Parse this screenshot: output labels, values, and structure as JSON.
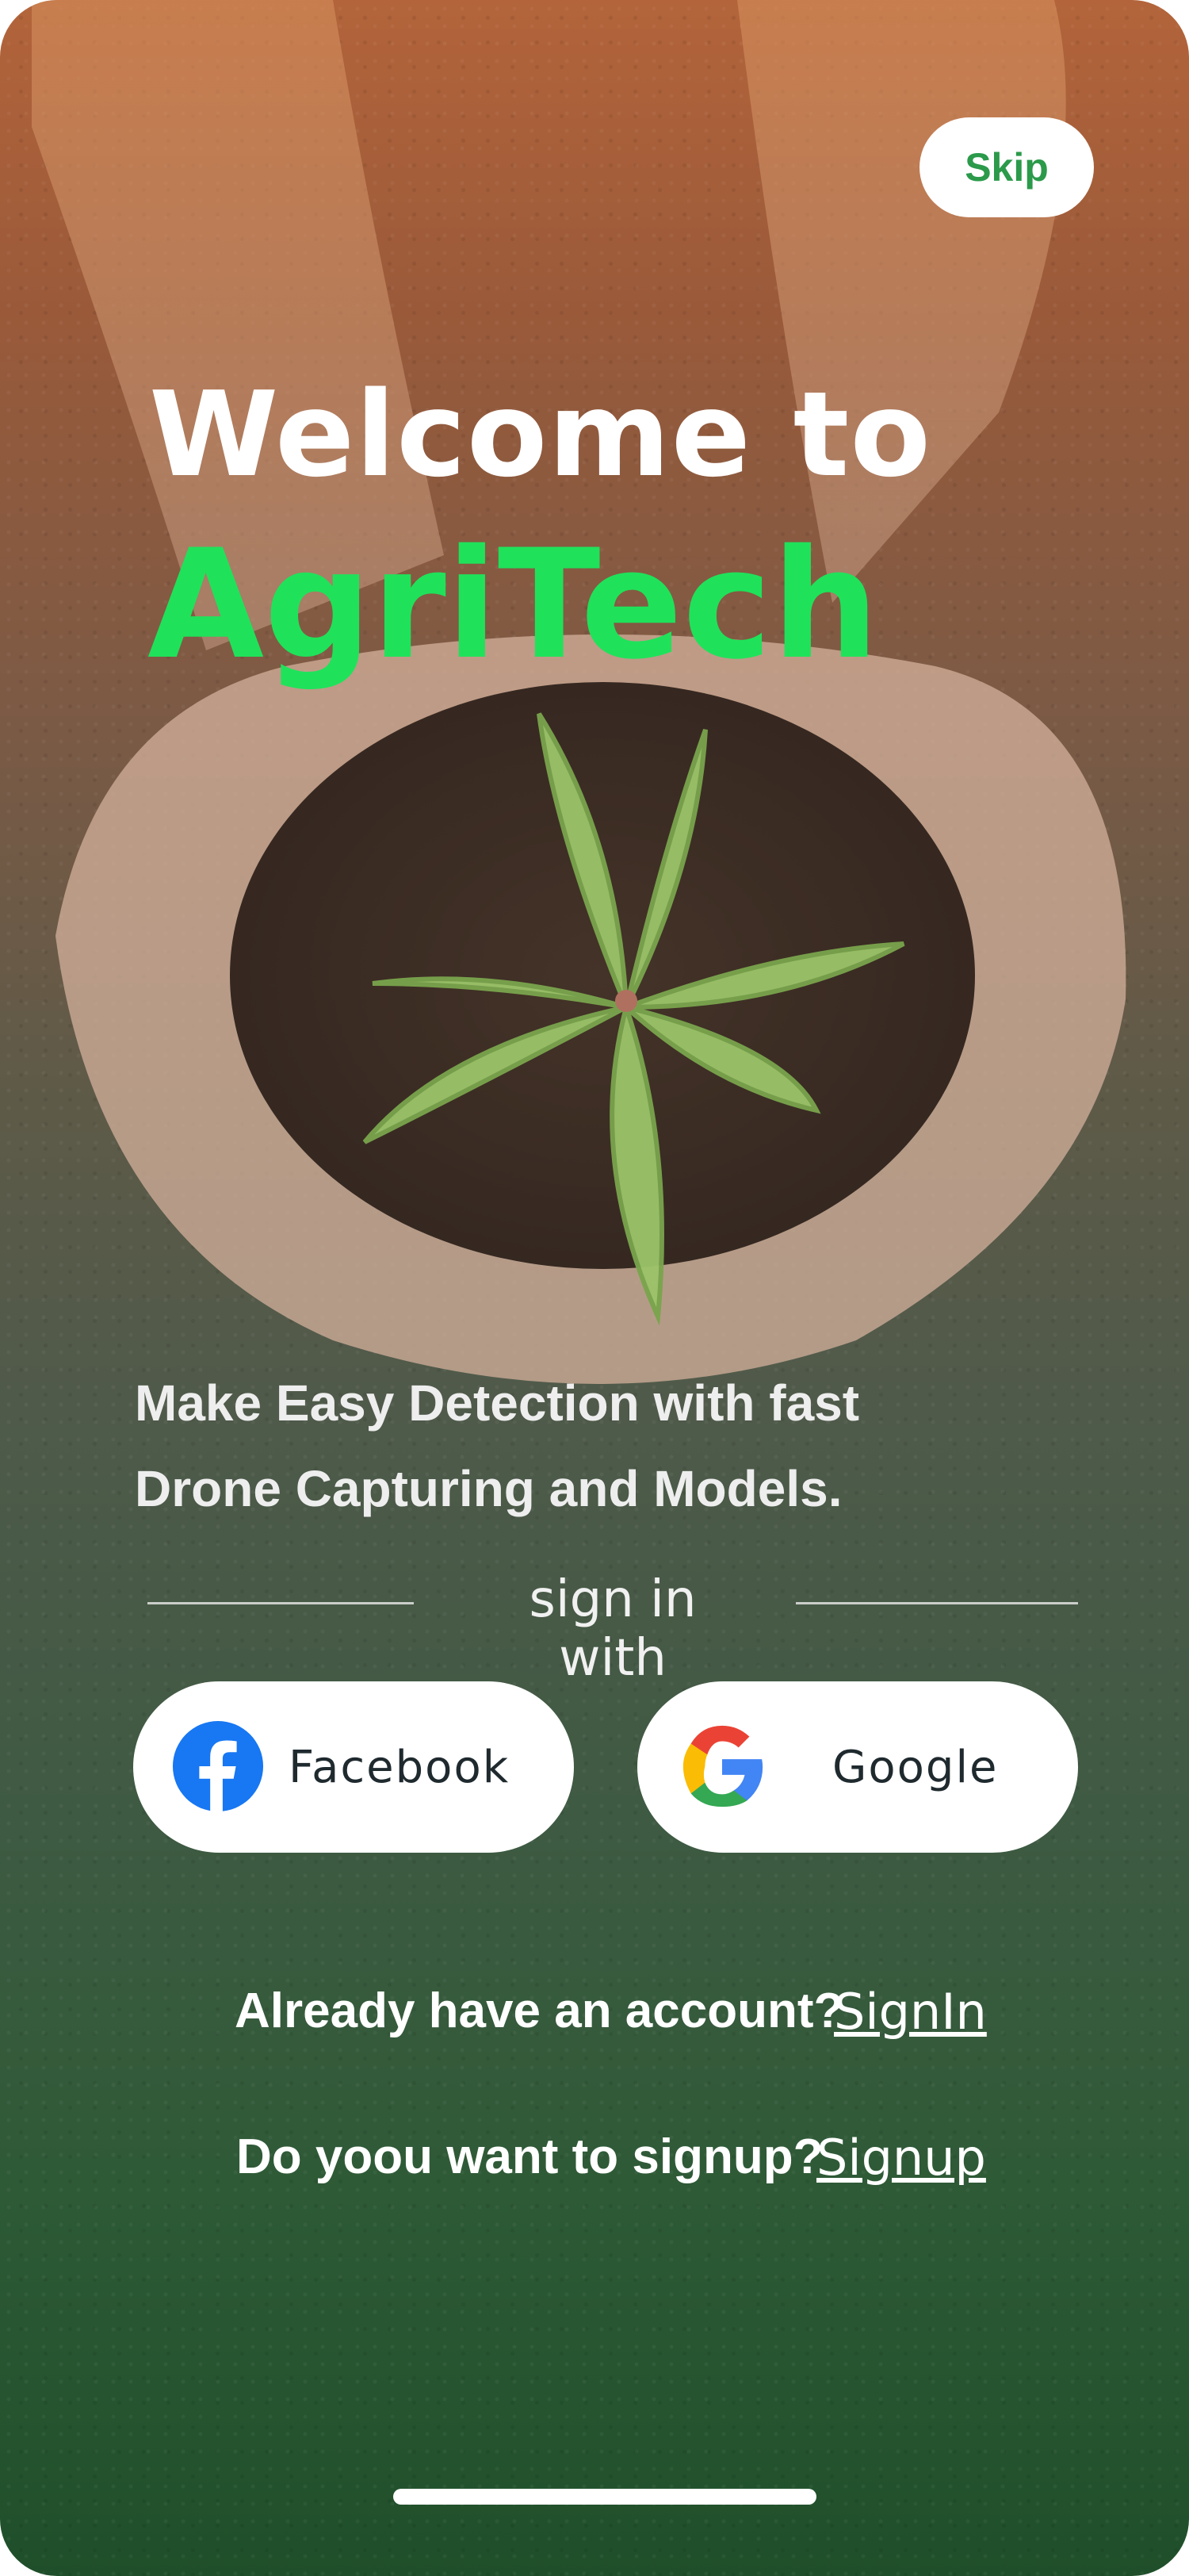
{
  "header": {
    "skip_label": "Skip"
  },
  "hero": {
    "title_line1": "Welcome to",
    "title_line2": "AgriTech"
  },
  "tagline": {
    "line1": "Make Easy Detection with fast",
    "line2": "Drone Capturing and Models."
  },
  "divider": {
    "text": "sign in with"
  },
  "social": {
    "facebook_label": "Facebook",
    "google_label": "Google"
  },
  "account": {
    "signin_prompt": "Already have an account?",
    "signin_link": "SignIn",
    "signup_prompt": "Do yoou want to signup?",
    "signup_link": "Signup"
  },
  "colors": {
    "accent_green": "#1fe25a",
    "skip_text": "#2b9a4a",
    "facebook_blue": "#1877f2"
  },
  "icons": [
    "facebook-icon",
    "google-icon"
  ]
}
